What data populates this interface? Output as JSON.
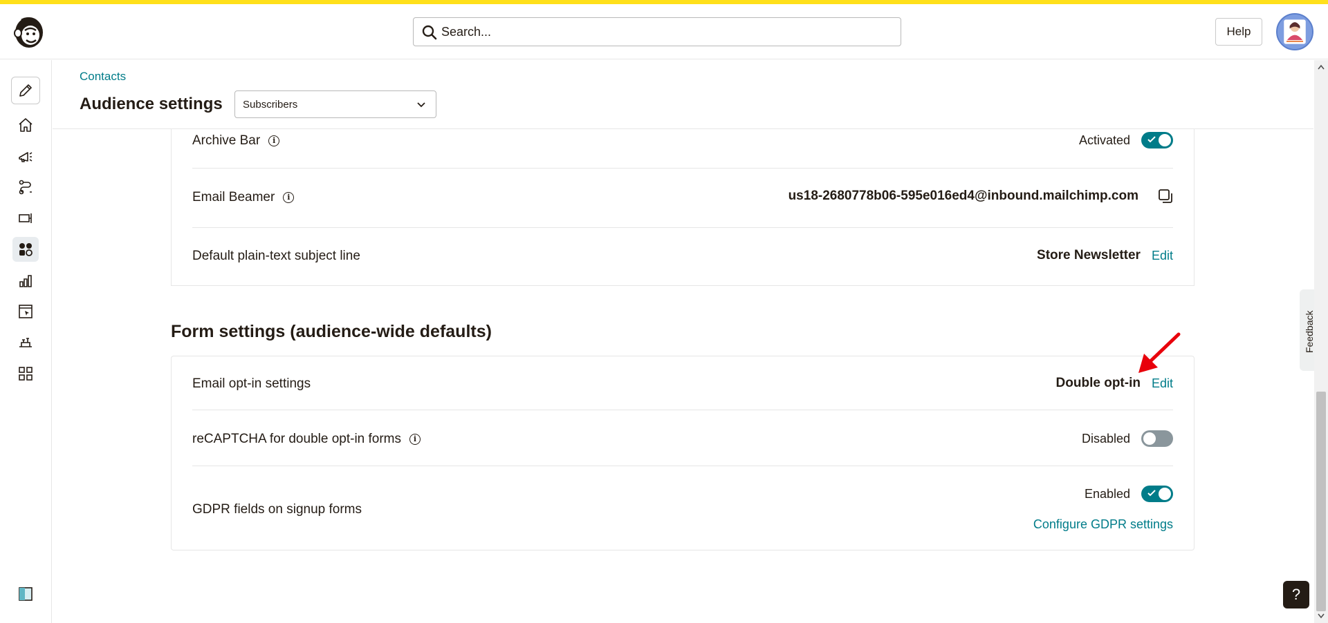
{
  "header": {
    "search_placeholder": "Search...",
    "help_label": "Help"
  },
  "sidebar": {
    "items": [
      {
        "icon": "pencil-icon"
      },
      {
        "icon": "home-icon"
      },
      {
        "icon": "megaphone-icon"
      },
      {
        "icon": "automation-icon"
      },
      {
        "icon": "signup-icon"
      },
      {
        "icon": "audience-icon",
        "active": true
      },
      {
        "icon": "analytics-icon"
      },
      {
        "icon": "website-icon"
      },
      {
        "icon": "integrations-icon"
      },
      {
        "icon": "grid-icon"
      }
    ],
    "bottom_icon": "panel-toggle-icon"
  },
  "page": {
    "breadcrumb": "Contacts",
    "title": "Audience settings",
    "audience_select": "Subscribers"
  },
  "top_card": {
    "archive_bar": {
      "label": "Archive Bar",
      "state": "Activated",
      "on": true
    },
    "email_beamer": {
      "label": "Email Beamer",
      "address": "us18-2680778b06-595e016ed4@inbound.mailchimp.com"
    },
    "subject_line": {
      "label": "Default plain-text subject line",
      "value": "Store Newsletter",
      "edit": "Edit"
    }
  },
  "form_settings": {
    "title": "Form settings (audience-wide defaults)",
    "optin": {
      "label": "Email opt-in settings",
      "value": "Double opt-in",
      "edit": "Edit"
    },
    "recaptcha": {
      "label": "reCAPTCHA for double opt-in forms",
      "state": "Disabled",
      "on": false
    },
    "gdpr": {
      "label": "GDPR fields on signup forms",
      "state": "Enabled",
      "on": true,
      "configure": "Configure GDPR settings"
    }
  },
  "feedback_label": "Feedback",
  "help_bubble": "?",
  "colors": {
    "accent": "#007c89",
    "brand_yellow": "#ffe01b",
    "annotation_arrow": "#e8000b"
  }
}
